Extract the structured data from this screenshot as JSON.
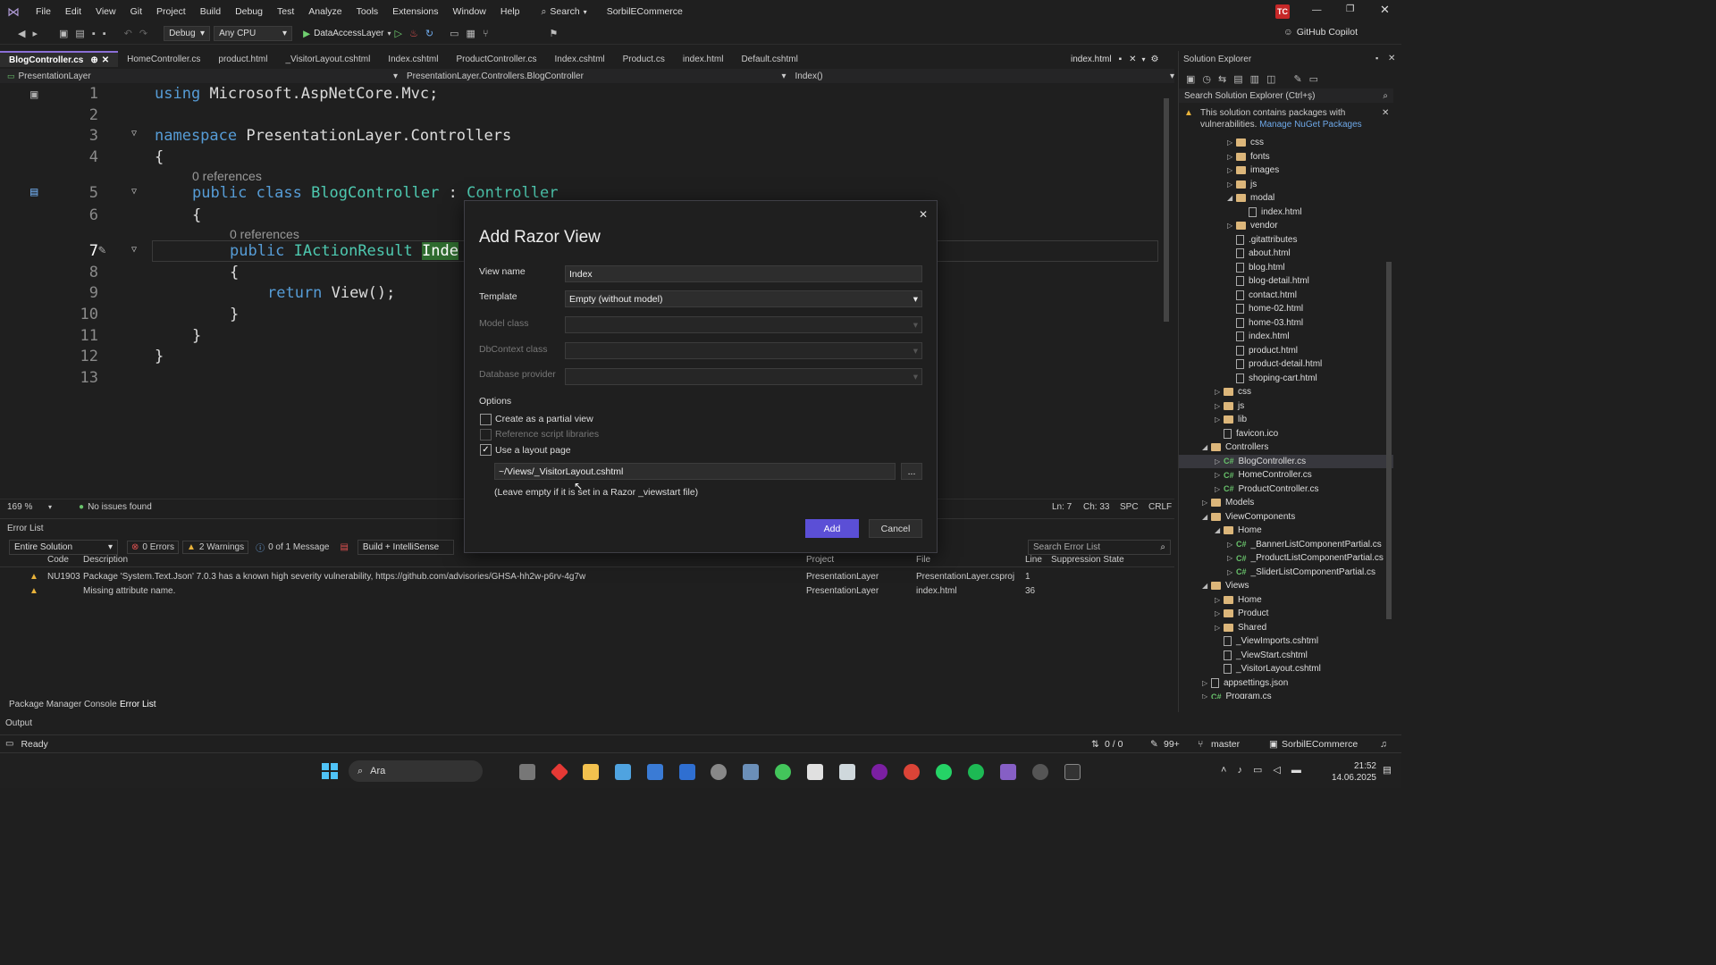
{
  "menu": {
    "items": [
      "File",
      "Edit",
      "View",
      "Git",
      "Project",
      "Build",
      "Debug",
      "Test",
      "Analyze",
      "Tools",
      "Extensions",
      "Window",
      "Help"
    ],
    "search_label": "Search",
    "solution_name": "SorbilECommerce",
    "user_initials": "TC"
  },
  "toolbar": {
    "config": "Debug",
    "platform": "Any CPU",
    "startup_project": "DataAccessLayer",
    "copilot_label": "GitHub Copilot"
  },
  "tabs": [
    {
      "label": "BlogController.cs",
      "active": true
    },
    {
      "label": "HomeController.cs"
    },
    {
      "label": "product.html"
    },
    {
      "label": "_VisitorLayout.cshtml"
    },
    {
      "label": "Index.cshtml"
    },
    {
      "label": "ProductController.cs"
    },
    {
      "label": "Index.cshtml"
    },
    {
      "label": "Product.cs"
    },
    {
      "label": "index.html"
    },
    {
      "label": "Default.cshtml"
    }
  ],
  "pinned_tab": "index.html",
  "navbar": {
    "project": "PresentationLayer",
    "class_path": "PresentationLayer.Controllers.BlogController",
    "member": "Index()"
  },
  "code": {
    "line_numbers": [
      "1",
      "2",
      "3",
      "4",
      "5",
      "6",
      "7",
      "8",
      "9",
      "10",
      "11",
      "12",
      "13"
    ],
    "l1_kw": "using",
    "l1_ns": "Microsoft.AspNetCore.Mvc;",
    "l3_kw": "namespace",
    "l3_ns": "PresentationLayer.Controllers",
    "brace_open": "{",
    "brace_close": "}",
    "refs_class": "0 references",
    "l5_kw": "public class",
    "l5_type": "BlogController",
    "l5_colon": ":",
    "l5_base": "Controller",
    "refs_method": "0 references",
    "l7_kw": "public",
    "l7_type": "IActionResult",
    "l7_name": "Inde",
    "l9_kw": "return",
    "l9_rest": "View();"
  },
  "editor_status": {
    "zoom": "169 %",
    "issues": "No issues found",
    "ln": "Ln: 7",
    "ch": "Ch: 33",
    "spc": "SPC",
    "crlf": "CRLF"
  },
  "error_list": {
    "title": "Error List",
    "scope": "Entire Solution",
    "errors": "0 Errors",
    "warnings": "2 Warnings",
    "messages": "0 of 1 Message",
    "build_filter": "Build + IntelliSense",
    "search_placeholder": "Search Error List",
    "columns": [
      "Code",
      "Description",
      "Project",
      "File",
      "Line",
      "Suppression State"
    ],
    "rows": [
      {
        "code": "NU1903",
        "description": "Package 'System.Text.Json' 7.0.3 has a known high severity vulnerability, https://github.com/advisories/GHSA-hh2w-p6rv-4g7w",
        "project": "PresentationLayer",
        "file": "PresentationLayer.csproj",
        "line": "1"
      },
      {
        "code": "",
        "description": "Missing attribute name.",
        "project": "PresentationLayer",
        "file": "index.html",
        "line": "36"
      }
    ]
  },
  "bottom_tabs": [
    "Package Manager Console",
    "Error List"
  ],
  "output_label": "Output",
  "dialog": {
    "title": "Add Razor View",
    "view_name_label": "View name",
    "view_name_value": "Index",
    "template_label": "Template",
    "template_value": "Empty (without model)",
    "model_class_label": "Model class",
    "dbcontext_label": "DbContext class",
    "db_provider_label": "Database provider",
    "options_label": "Options",
    "partial_label": "Create as a partial view",
    "ref_scripts_label": "Reference script libraries",
    "layout_label": "Use a layout page",
    "layout_path": "~/Views/_VisitorLayout.cshtml",
    "browse_label": "...",
    "hint": "(Leave empty if it is set in a Razor _viewstart file)",
    "add_label": "Add",
    "cancel_label": "Cancel"
  },
  "solution_explorer": {
    "title": "Solution Explorer",
    "search_placeholder": "Search Solution Explorer (Ctrl+ş)",
    "warning_text": "This solution contains packages with vulnerabilities.",
    "warning_link": "Manage NuGet Packages",
    "items": [
      {
        "label": "css",
        "type": "folder",
        "indent": 3,
        "arrow": "▷"
      },
      {
        "label": "fonts",
        "type": "folder",
        "indent": 3,
        "arrow": "▷"
      },
      {
        "label": "images",
        "type": "folder",
        "indent": 3,
        "arrow": "▷"
      },
      {
        "label": "js",
        "type": "folder",
        "indent": 3,
        "arrow": "▷"
      },
      {
        "label": "modal",
        "type": "folder",
        "indent": 3,
        "arrow": "◢"
      },
      {
        "label": "index.html",
        "type": "file",
        "indent": 4,
        "arrow": ""
      },
      {
        "label": "vendor",
        "type": "folder",
        "indent": 3,
        "arrow": "▷"
      },
      {
        "label": ".gitattributes",
        "type": "file",
        "indent": 3,
        "arrow": ""
      },
      {
        "label": "about.html",
        "type": "file",
        "indent": 3,
        "arrow": ""
      },
      {
        "label": "blog.html",
        "type": "file",
        "indent": 3,
        "arrow": ""
      },
      {
        "label": "blog-detail.html",
        "type": "file",
        "indent": 3,
        "arrow": ""
      },
      {
        "label": "contact.html",
        "type": "file",
        "indent": 3,
        "arrow": ""
      },
      {
        "label": "home-02.html",
        "type": "file",
        "indent": 3,
        "arrow": ""
      },
      {
        "label": "home-03.html",
        "type": "file",
        "indent": 3,
        "arrow": ""
      },
      {
        "label": "index.html",
        "type": "file",
        "indent": 3,
        "arrow": ""
      },
      {
        "label": "product.html",
        "type": "file",
        "indent": 3,
        "arrow": ""
      },
      {
        "label": "product-detail.html",
        "type": "file",
        "indent": 3,
        "arrow": ""
      },
      {
        "label": "shoping-cart.html",
        "type": "file",
        "indent": 3,
        "arrow": ""
      },
      {
        "label": "css",
        "type": "folder",
        "indent": 2,
        "arrow": "▷"
      },
      {
        "label": "js",
        "type": "folder",
        "indent": 2,
        "arrow": "▷"
      },
      {
        "label": "lib",
        "type": "folder",
        "indent": 2,
        "arrow": "▷"
      },
      {
        "label": "favicon.ico",
        "type": "file",
        "indent": 2,
        "arrow": ""
      },
      {
        "label": "Controllers",
        "type": "folder",
        "indent": 1,
        "arrow": "◢"
      },
      {
        "label": "BlogController.cs",
        "type": "cs",
        "indent": 2,
        "arrow": "▷",
        "selected": true
      },
      {
        "label": "HomeController.cs",
        "type": "cs",
        "indent": 2,
        "arrow": "▷"
      },
      {
        "label": "ProductController.cs",
        "type": "cs",
        "indent": 2,
        "arrow": "▷"
      },
      {
        "label": "Models",
        "type": "folder",
        "indent": 1,
        "arrow": "▷"
      },
      {
        "label": "ViewComponents",
        "type": "folder",
        "indent": 1,
        "arrow": "◢"
      },
      {
        "label": "Home",
        "type": "folder",
        "indent": 2,
        "arrow": "◢"
      },
      {
        "label": "_BannerListComponentPartial.cs",
        "type": "cs",
        "indent": 3,
        "arrow": "▷"
      },
      {
        "label": "_ProductListComponentPartial.cs",
        "type": "cs",
        "indent": 3,
        "arrow": "▷"
      },
      {
        "label": "_SliderListComponentPartial.cs",
        "type": "cs",
        "indent": 3,
        "arrow": "▷"
      },
      {
        "label": "Views",
        "type": "folder",
        "indent": 1,
        "arrow": "◢"
      },
      {
        "label": "Home",
        "type": "folder",
        "indent": 2,
        "arrow": "▷"
      },
      {
        "label": "Product",
        "type": "folder",
        "indent": 2,
        "arrow": "▷"
      },
      {
        "label": "Shared",
        "type": "folder",
        "indent": 2,
        "arrow": "▷"
      },
      {
        "label": "_ViewImports.cshtml",
        "type": "file",
        "indent": 2,
        "arrow": ""
      },
      {
        "label": "_ViewStart.cshtml",
        "type": "file",
        "indent": 2,
        "arrow": ""
      },
      {
        "label": "_VisitorLayout.cshtml",
        "type": "file",
        "indent": 2,
        "arrow": ""
      },
      {
        "label": "appsettings.json",
        "type": "file",
        "indent": 1,
        "arrow": "▷"
      },
      {
        "label": "Program.cs",
        "type": "cs",
        "indent": 1,
        "arrow": "▷"
      }
    ]
  },
  "statusbar": {
    "ready": "Ready",
    "lines": "0 / 0",
    "zoom": "99+",
    "branch": "master",
    "repo": "SorbilECommerce"
  },
  "taskbar": {
    "search_label": "Ara",
    "time": "21:52",
    "date": "14.06.2025"
  },
  "colors": {
    "accent": "#8b6fd6",
    "add_button": "#5b4fd6",
    "warning": "#e8b23a",
    "error": "#e05252",
    "keyword": "#569cd6",
    "type": "#4ec9b0"
  }
}
